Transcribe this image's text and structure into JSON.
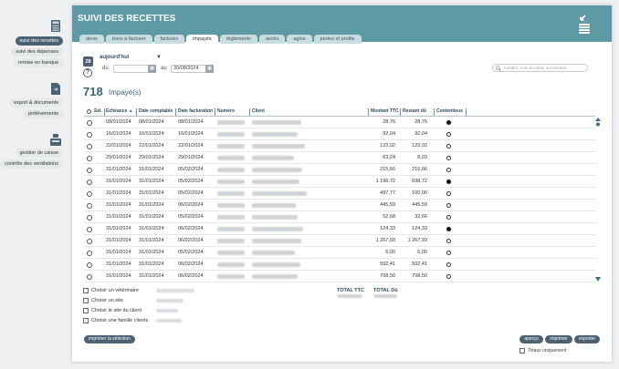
{
  "sidebar": {
    "items": [
      {
        "label": "suivi des recettes",
        "active": true
      },
      {
        "label": "suivi des dépenses",
        "active": false
      },
      {
        "label": "remise en banque",
        "active": false
      },
      {
        "label": "export & documents",
        "active": false
      },
      {
        "label": "prélèvements",
        "active": false
      },
      {
        "label": "gestion de caisse",
        "active": false
      },
      {
        "label": "contrôle des ventilations",
        "active": false
      }
    ]
  },
  "header": {
    "title": "SUIVI DES RECETTES"
  },
  "tabs": [
    {
      "label": "devis",
      "active": false
    },
    {
      "label": "bons à facturer",
      "active": false
    },
    {
      "label": "factures",
      "active": false
    },
    {
      "label": "impayés",
      "active": true
    },
    {
      "label": "règlements",
      "active": false
    },
    {
      "label": "avoirs",
      "active": false
    },
    {
      "label": "agios",
      "active": false
    },
    {
      "label": "pertes et profits",
      "active": false
    }
  ],
  "filters": {
    "period": "aujourd'hui",
    "calendar_day": "28",
    "from_label": "du",
    "from_value": "",
    "to_label": "au",
    "to_value": "30/08/2024",
    "search_placeholder": "numéro, nom du client ou montant"
  },
  "summary": {
    "count": "718",
    "label": "Impayé(s)"
  },
  "table": {
    "headers": {
      "sel": "Sél.",
      "echeance": "Echéance",
      "sort": "▲",
      "date_comptable": "Date comptable",
      "date_facturation": "Date facturation",
      "numero": "Numéro",
      "client": "Client",
      "montant_ttc": "Montant TTC",
      "restant_du": "Restant dû",
      "contentieux": "Contentieux"
    },
    "rows": [
      {
        "echeance": "08/01/2024",
        "comptable": "08/01/2024",
        "facturation": "08/01/2024",
        "ttc": "28,76",
        "du": "28,76",
        "contentieux": true
      },
      {
        "echeance": "16/01/2024",
        "comptable": "16/01/2024",
        "facturation": "16/01/2024",
        "ttc": "92,04",
        "du": "92,04",
        "contentieux": false
      },
      {
        "echeance": "22/01/2024",
        "comptable": "22/01/2024",
        "facturation": "22/01/2024",
        "ttc": "123,02",
        "du": "123,02",
        "contentieux": false
      },
      {
        "echeance": "29/01/2024",
        "comptable": "29/01/2024",
        "facturation": "29/01/2024",
        "ttc": "63,24",
        "du": "8,03",
        "contentieux": false
      },
      {
        "echeance": "31/01/2024",
        "comptable": "31/01/2024",
        "facturation": "05/02/2024",
        "ttc": "215,66",
        "du": "215,66",
        "contentieux": false
      },
      {
        "echeance": "31/01/2024",
        "comptable": "31/01/2024",
        "facturation": "05/02/2024",
        "ttc": "1 196,72",
        "du": "698,72",
        "contentieux": true
      },
      {
        "echeance": "31/01/2024",
        "comptable": "31/01/2024",
        "facturation": "05/02/2024",
        "ttc": "497,77",
        "du": "100,00",
        "contentieux": false
      },
      {
        "echeance": "31/01/2024",
        "comptable": "31/01/2024",
        "facturation": "06/02/2024",
        "ttc": "445,59",
        "du": "445,59",
        "contentieux": false
      },
      {
        "echeance": "31/01/2024",
        "comptable": "31/01/2024",
        "facturation": "05/02/2024",
        "ttc": "52,68",
        "du": "32,66",
        "contentieux": false
      },
      {
        "echeance": "31/01/2024",
        "comptable": "31/01/2024",
        "facturation": "06/02/2024",
        "ttc": "124,33",
        "du": "124,33",
        "contentieux": true
      },
      {
        "echeance": "31/01/2024",
        "comptable": "31/01/2024",
        "facturation": "06/02/2024",
        "ttc": "1 267,93",
        "du": "1 267,93",
        "contentieux": false
      },
      {
        "echeance": "31/01/2024",
        "comptable": "31/01/2024",
        "facturation": "05/02/2024",
        "ttc": "6,00",
        "du": "6,00",
        "contentieux": false
      },
      {
        "echeance": "31/01/2024",
        "comptable": "31/01/2024",
        "facturation": "06/02/2024",
        "ttc": "502,41",
        "du": "502,41",
        "contentieux": false
      },
      {
        "echeance": "31/01/2024",
        "comptable": "31/01/2024",
        "facturation": "06/02/2024",
        "ttc": "708,50",
        "du": "708,50",
        "contentieux": false
      }
    ]
  },
  "options": {
    "veterinaire": "Choisir un vétérinaire",
    "site": "Choisir un site",
    "site_client": "Choisir le site du client",
    "famille_clients": "Choisir une famille clients"
  },
  "totals": {
    "ttc_label": "TOTAL TTC",
    "du_label": "TOTAL Dû"
  },
  "buttons": {
    "print_selection": "imprimer la sélection",
    "preview": "aperçu",
    "print": "imprimer",
    "export": "exporter"
  },
  "totals_only": "Totaux uniquement",
  "colors": {
    "header": "#5e9aa5",
    "dark": "#4a6272",
    "tab": "#c9dde1"
  }
}
